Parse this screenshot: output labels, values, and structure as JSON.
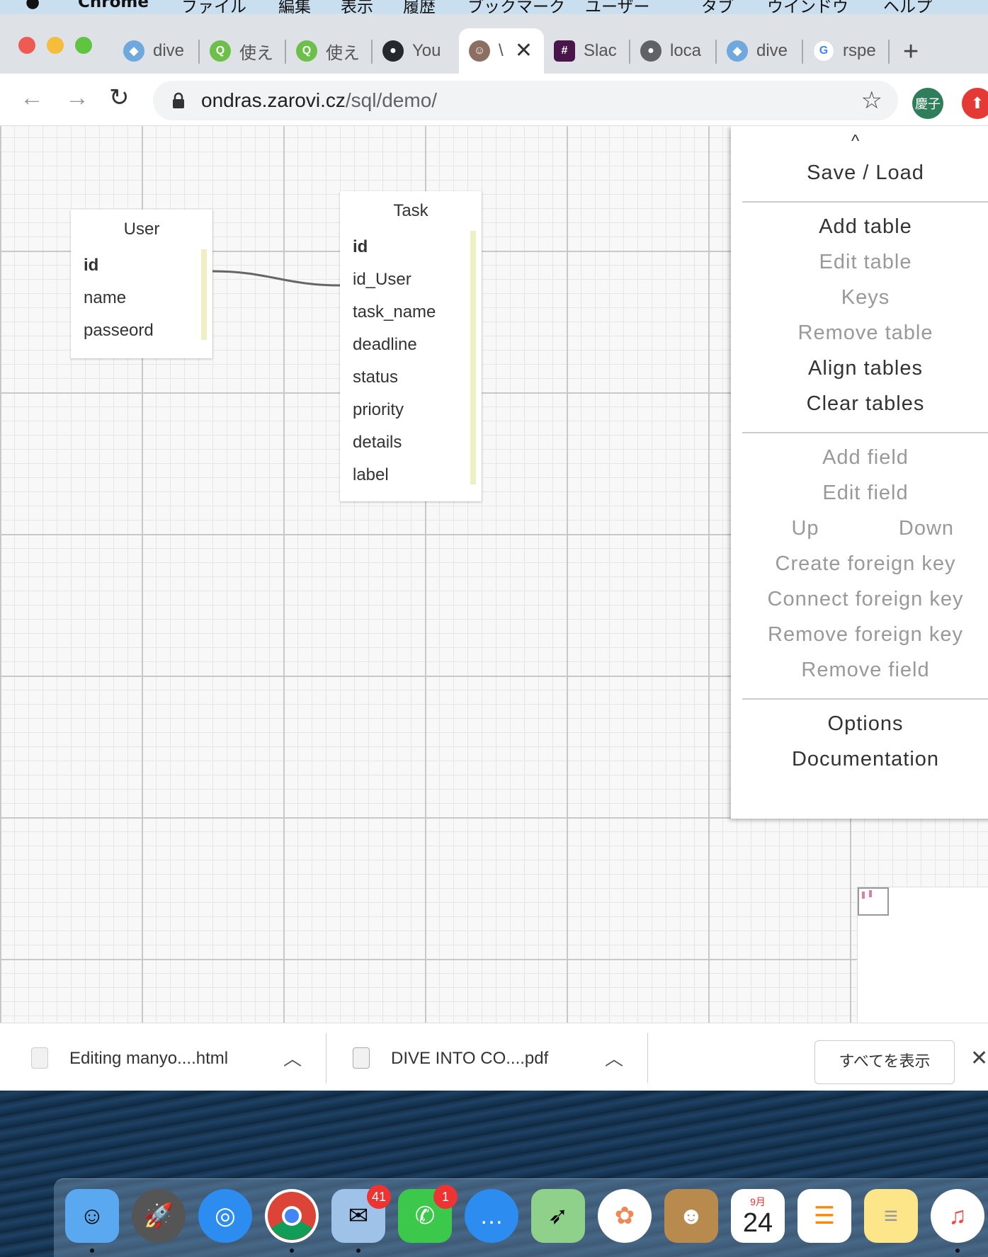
{
  "menubar": {
    "items": [
      "Chrome",
      "ファイル",
      "編集",
      "表示",
      "履歴",
      "ブックマーク",
      "ユーザー",
      "タブ",
      "ウインドウ",
      "ヘルプ"
    ]
  },
  "browser": {
    "tabs": [
      {
        "title": "dive",
        "icon": "globe-blue-icon",
        "color": "#6fa8dc",
        "active": false
      },
      {
        "title": "使え",
        "icon": "green-q-icon",
        "color": "#6cc04a",
        "active": false
      },
      {
        "title": "使え",
        "icon": "green-q-icon",
        "color": "#6cc04a",
        "active": false
      },
      {
        "title": "You",
        "icon": "github-icon",
        "color": "#24292e",
        "active": false
      },
      {
        "title": "\\",
        "icon": "avatar-face-icon",
        "color": "#8d6e63",
        "active": true
      },
      {
        "title": "Slac",
        "icon": "slack-icon",
        "color": "#4a154b",
        "active": false
      },
      {
        "title": "loca",
        "icon": "globe-gray-icon",
        "color": "#5f6368",
        "active": false
      },
      {
        "title": "dive",
        "icon": "globe-blue-icon",
        "color": "#6fa8dc",
        "active": false
      },
      {
        "title": "rspe",
        "icon": "google-icon",
        "color": "#4285f4",
        "active": false
      }
    ],
    "url_host": "ondras.zarovi.cz",
    "url_path": "/sql/demo/",
    "profile": "慶子"
  },
  "tables": [
    {
      "name": "User",
      "fields": [
        "id",
        "name",
        "passeord"
      ],
      "primary": "id"
    },
    {
      "name": "Task",
      "fields": [
        "id",
        "id_User",
        "task_name",
        "deadline",
        "status",
        "priority",
        "details",
        "label"
      ],
      "primary": "id"
    }
  ],
  "sidemenu": {
    "collapse": "^",
    "save_load": "Save / Load",
    "add_table": "Add table",
    "edit_table": "Edit table",
    "keys": "Keys",
    "remove_table": "Remove table",
    "align_tables": "Align tables",
    "clear_tables": "Clear tables",
    "add_field": "Add field",
    "edit_field": "Edit field",
    "up": "Up",
    "down": "Down",
    "create_fk": "Create foreign key",
    "connect_fk": "Connect foreign key",
    "remove_fk": "Remove foreign key",
    "remove_field": "Remove field",
    "options": "Options",
    "documentation": "Documentation"
  },
  "downloads": {
    "items": [
      {
        "name": "Editing manyo....html",
        "icon": "chrome-file-icon"
      },
      {
        "name": "DIVE INTO CO....pdf",
        "icon": "pdf-file-icon"
      }
    ],
    "show_all": "すべてを表示"
  },
  "dock": {
    "apps": [
      "Finder",
      "Launchpad",
      "Safari",
      "Chrome",
      "Mail",
      "FaceTime",
      "Messages",
      "Maps",
      "Photos",
      "Contacts",
      "Calendar",
      "Reminders",
      "Notes",
      "Music"
    ],
    "mail_badge": "41",
    "facetime_badge": "1",
    "calendar_month": "9月",
    "calendar_day": "24"
  }
}
